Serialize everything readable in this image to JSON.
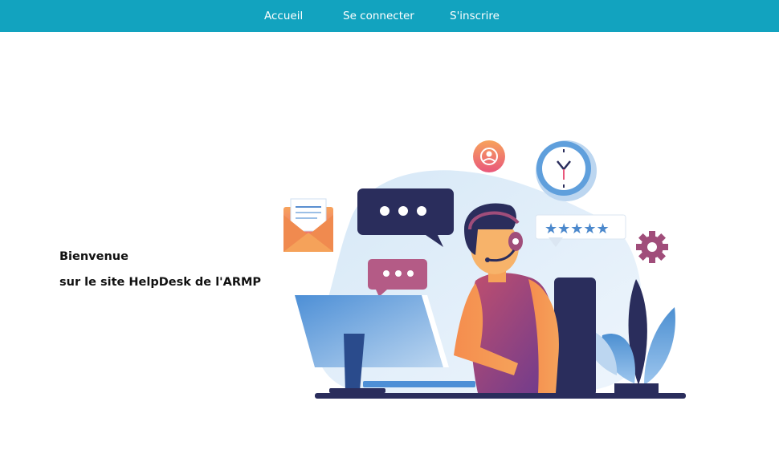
{
  "nav": {
    "items": [
      {
        "label": "Accueil"
      },
      {
        "label": "Se connecter"
      },
      {
        "label": "S'inscrire"
      }
    ]
  },
  "hero": {
    "line1": "Bienvenue",
    "line2": "sur le site HelpDesk de l'ARMP"
  },
  "colors": {
    "nav_bg": "#12a3bf",
    "nav_text": "#ffffff",
    "text": "#111111"
  },
  "illustration": {
    "icons": [
      "envelope-icon",
      "chat-bubble-icon",
      "user-icon",
      "clock-icon",
      "stars-rating-icon",
      "gear-icon",
      "plant-icon",
      "computer-monitor-icon",
      "headset-agent-icon"
    ]
  }
}
